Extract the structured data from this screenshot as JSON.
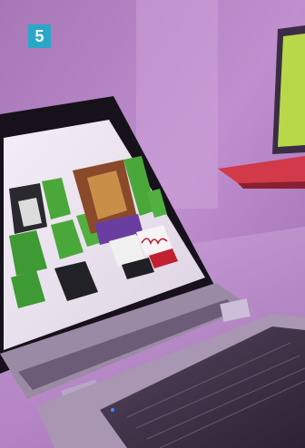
{
  "badge": {
    "number": "5",
    "color": "#2aa7c7"
  },
  "photo": {
    "subject": "convertible-tablet-with-keyboard-dock",
    "tint": "#b07fbe"
  }
}
